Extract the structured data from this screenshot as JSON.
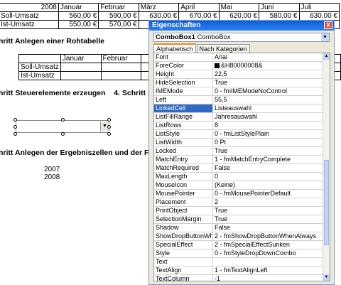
{
  "sheet": {
    "table1": {
      "header": [
        "2008",
        "Januar",
        "Februar",
        "März",
        "April",
        "Mai",
        "Juni",
        "Juli"
      ],
      "rows": [
        [
          "Soll-Umsatz",
          "560,00 €",
          "590,00 €",
          "630,00 €",
          "670,00 €",
          "620,00 €",
          "580,00 €",
          "630,00 €"
        ],
        [
          "Ist-Umsatz",
          "550,00 €",
          "570,00 €",
          "",
          "",
          "",
          "",
          ""
        ]
      ]
    },
    "heading_rohtabelle": "hritt Anlegen einer Rohtabelle",
    "table2": {
      "header": [
        "",
        "Januar",
        "Februar",
        "",
        "",
        "",
        "",
        ""
      ],
      "rows": [
        [
          "Soll-Umsatz",
          "",
          "",
          "",
          "",
          "",
          "",
          ""
        ],
        [
          "Ist-Umsatz",
          "",
          "",
          "",
          "",
          "",
          "",
          ""
        ]
      ]
    },
    "heading_steuerelemente": "hritt Steuerelemente erzeugen    4. Schritt Steue",
    "heading_ergebnis": "hritt Anlegen der Ergebniszellen und der Füllist",
    "years": [
      "2007",
      "2008"
    ]
  },
  "properties": {
    "title": "Eigenschaften",
    "close_label": "X",
    "object_name": "ComboBox1",
    "object_type": "ComboBox",
    "tabs": [
      "Alphabetisch",
      "Nach Kategorien"
    ],
    "rows": [
      {
        "name": "Font",
        "value": "Arial"
      },
      {
        "name": "ForeColor",
        "value": "&H80000008&"
      },
      {
        "name": "Height",
        "value": "22,5"
      },
      {
        "name": "HideSelection",
        "value": "True"
      },
      {
        "name": "IMEMode",
        "value": "0 - fmIMEModeNoControl"
      },
      {
        "name": "Left",
        "value": "55,5"
      },
      {
        "name": "LinkedCell",
        "value": "Listeauswahl"
      },
      {
        "name": "ListFillRange",
        "value": "Jahresauswahl"
      },
      {
        "name": "ListRows",
        "value": "8"
      },
      {
        "name": "ListStyle",
        "value": "0 - fmListStylePlain"
      },
      {
        "name": "ListWidth",
        "value": "0 Pt"
      },
      {
        "name": "Locked",
        "value": "True"
      },
      {
        "name": "MatchEntry",
        "value": "1 - fmMatchEntryComplete"
      },
      {
        "name": "MatchRequired",
        "value": "False"
      },
      {
        "name": "MaxLength",
        "value": "0"
      },
      {
        "name": "MouseIcon",
        "value": "(Keine)"
      },
      {
        "name": "MousePointer",
        "value": "0 - fmMousePointerDefault"
      },
      {
        "name": "Placement",
        "value": "2"
      },
      {
        "name": "PrintObject",
        "value": "True"
      },
      {
        "name": "SelectionMargin",
        "value": "True"
      },
      {
        "name": "Shadow",
        "value": "False"
      },
      {
        "name": "ShowDropButtonWhen",
        "value": "2 - fmShowDropButtonWhenAlways"
      },
      {
        "name": "SpecialEffect",
        "value": "2 - fmSpecialEffectSunken"
      },
      {
        "name": "Style",
        "value": "0 - fmStyleDropDownCombo"
      },
      {
        "name": "Text",
        "value": ""
      },
      {
        "name": "TextAlign",
        "value": "1 - fmTextAlignLeft"
      },
      {
        "name": "TextColumn",
        "value": "-1"
      }
    ],
    "selected_row": "LinkedCell"
  }
}
